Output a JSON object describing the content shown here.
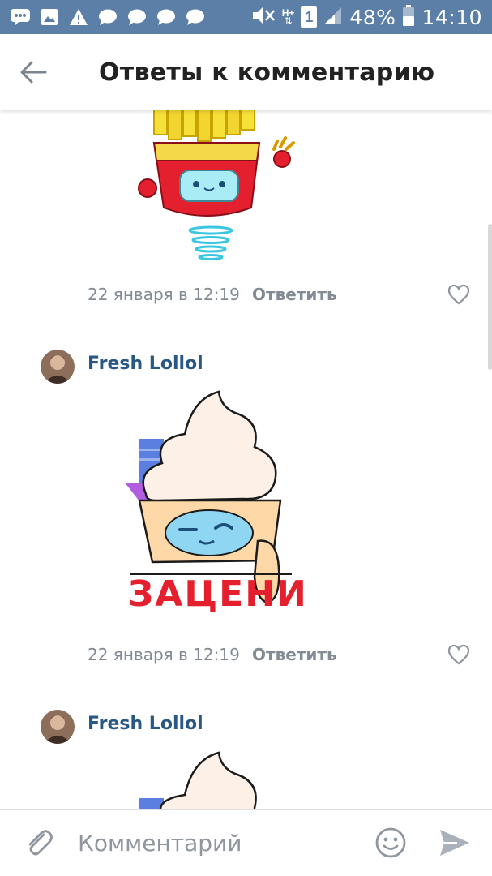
{
  "status_bar": {
    "battery": "48%",
    "time": "14:10",
    "network": "H+",
    "sim": "1",
    "left_icons": [
      "chat-icon",
      "image-icon",
      "warning-icon",
      "message-icon",
      "message-icon",
      "message-icon",
      "message-icon"
    ]
  },
  "header": {
    "title": "Ответы к комментарию",
    "back_icon": "arrow-left-icon"
  },
  "comments": [
    {
      "date": "22 января в 12:19",
      "reply_label": "Ответить",
      "sticker": "french-fries-sticker"
    },
    {
      "author": "Fresh Lollol",
      "date": "22 января в 12:19",
      "reply_label": "Ответить",
      "sticker": "ice-cream-sticker",
      "sticker_text": "ЗАЦЕНИ"
    },
    {
      "author": "Fresh Lollol",
      "sticker": "ice-cream-sticker"
    }
  ],
  "compose": {
    "placeholder": "Комментарий"
  },
  "colors": {
    "status_bar": "#5b7fa6",
    "link": "#2a5885",
    "meta": "#828a93",
    "sticker_red": "#e5202e"
  }
}
